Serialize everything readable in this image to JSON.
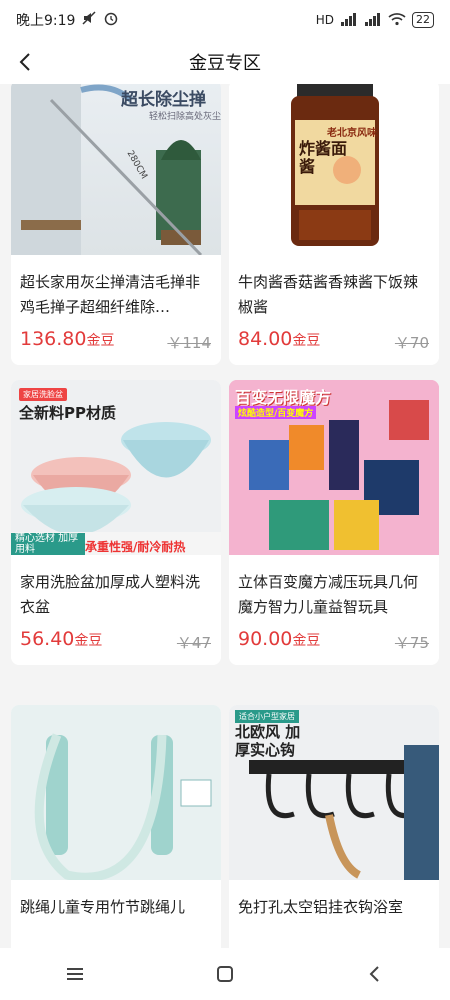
{
  "status": {
    "time": "晚上9:19",
    "network": "HD",
    "battery": "22"
  },
  "header": {
    "title": "金豆专区"
  },
  "products": [
    {
      "name": "超长家用灰尘掸清洁毛掸非鸡毛掸子超细纤维除…",
      "price": "136.80",
      "unit": "金豆",
      "original": "￥114",
      "banner": "超长除尘掸",
      "sub_banner": "轻松扫除高处灰尘",
      "length_mark": "280CM"
    },
    {
      "name": "牛肉酱香菇酱香辣酱下饭辣椒酱",
      "price": "84.00",
      "unit": "金豆",
      "original": "￥70",
      "label": "炸酱面酱",
      "brand": "老北京风味"
    },
    {
      "name": "家用洗脸盆加厚成人塑料洗衣盆",
      "price": "56.40",
      "unit": "金豆",
      "original": "￥47",
      "banner": "全新料PP材质",
      "tag": "家居洗脸盆",
      "footer_left": "精心选材 加厚用料",
      "footer_right": "承重性强/耐冷耐热"
    },
    {
      "name": "立体百变魔方减压玩具几何魔方智力儿童益智玩具",
      "price": "90.00",
      "unit": "金豆",
      "original": "￥75",
      "banner": "百变无限魔方",
      "sub_banner": "炫酷造型/百变魔方"
    },
    {
      "name": "跳绳儿童专用竹节跳绳儿",
      "price": "",
      "unit": "",
      "original": ""
    },
    {
      "name": "免打孔太空铝挂衣钩浴室",
      "price": "",
      "unit": "",
      "original": "",
      "banner": "北欧风 加厚实心钩",
      "tag": "适合小户型家居"
    }
  ]
}
